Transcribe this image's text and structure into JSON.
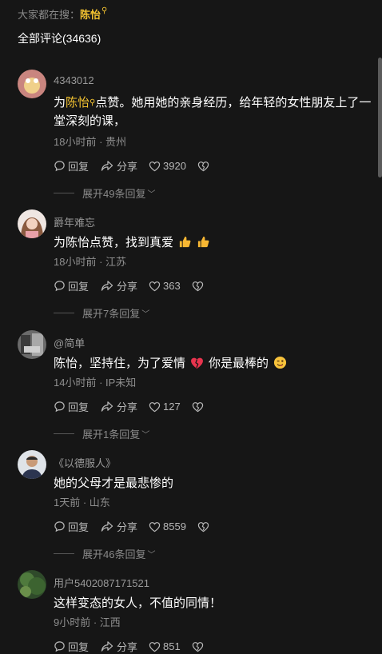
{
  "search_bar": {
    "prefix": "大家都在搜：",
    "keyword": "陈怡"
  },
  "comments_count": "全部评论(34636)",
  "action_labels": {
    "reply": "回复",
    "share": "分享"
  },
  "comments": [
    {
      "username": "4343012",
      "text_prefix": "为",
      "text_highlight": "陈怡",
      "text_rest": "点赞。她用她的亲身经历，给年轻的女性朋友上了一堂深刻的课，",
      "meta": "18小时前 · 贵州",
      "likes": "3920",
      "expand": "展开49条回复"
    },
    {
      "username": "爵年难忘",
      "text": "为陈怡点赞，找到真爱",
      "meta": "18小时前 · 江苏",
      "likes": "363",
      "expand": "展开7条回复"
    },
    {
      "username": "@简单",
      "text_a": "陈怡，坚持住，为了爱情",
      "text_b": "你是最棒的",
      "meta": "14小时前 · IP未知",
      "likes": "127",
      "expand": "展开1条回复"
    },
    {
      "username": "《以德服人》",
      "text": "她的父母才是最悲惨的",
      "meta": "1天前 · 山东",
      "likes": "8559",
      "expand": "展开46条回复"
    },
    {
      "username": "用户5402087171521",
      "text": "这样变态的女人，不值的同情！",
      "meta": "9小时前 · 江西",
      "likes": "851"
    }
  ]
}
